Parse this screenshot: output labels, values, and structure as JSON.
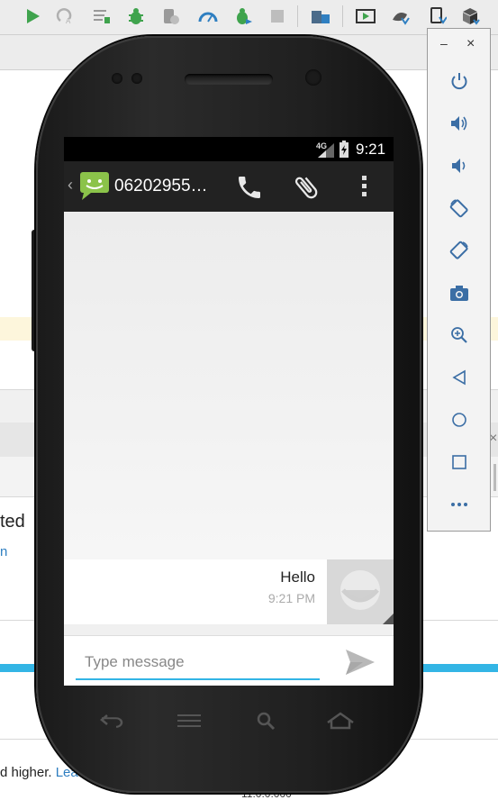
{
  "ide": {
    "toolbar_icons": [
      "run-icon",
      "rerun-icon",
      "coverage-icon",
      "debug-icon",
      "profile-icon",
      "profiler-gauge-icon",
      "attach-debugger-icon",
      "stop-icon",
      "project-structure-icon",
      "avd-manager-icon",
      "sdk-manager-icon",
      "device-file-icon",
      "build-variants-icon"
    ],
    "snippet_1": "ted",
    "snippet_2": "n",
    "snippet_3_text": "d higher.",
    "snippet_3_link": "Lea",
    "snippet_4": "11.0.0.000"
  },
  "device": {
    "status": {
      "network": "4G",
      "time": "9:21"
    },
    "action_bar": {
      "contact": "06202955…"
    },
    "message": {
      "text": "Hello",
      "time": "9:21 PM"
    },
    "compose": {
      "placeholder": "Type message"
    }
  },
  "emulator_panel": {
    "minimize": "–",
    "close": "×",
    "buttons": [
      "power-icon",
      "volume-up-icon",
      "volume-down-icon",
      "rotate-left-icon",
      "rotate-right-icon",
      "screenshot-icon",
      "zoom-icon",
      "back-icon",
      "home-icon",
      "overview-icon",
      "more-icon"
    ]
  },
  "colors": {
    "accent_blue": "#33b5e5",
    "ide_toolbar_bg": "#ececec",
    "sms_green": "#8bc34a"
  }
}
